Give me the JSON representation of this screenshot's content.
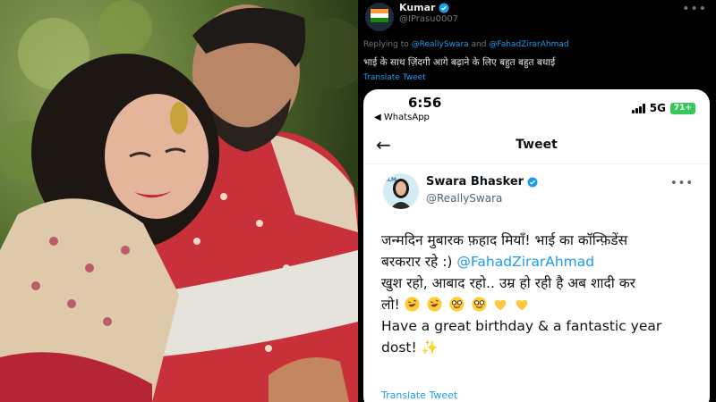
{
  "reply_tweet": {
    "author_name": "Kumar",
    "author_handle": "@IPrasu0007",
    "replying_prefix": "Replying to",
    "replying_to_1": "@ReallySwara",
    "replying_and": "and",
    "replying_to_2": "@FahadZirarAhmad",
    "text": "भाई के साथ ज़िंदगी आगे बढ़ाने के लिए बहुत बहुत बधाई",
    "translate_label": "Translate Tweet",
    "more_glyph": "•••"
  },
  "phone_status": {
    "time": "6:56",
    "back_app": "◀ WhatsApp",
    "network": "5G",
    "battery": "71+"
  },
  "tweet_screen": {
    "back_glyph": "←",
    "title": "Tweet",
    "author_name": "Swara Bhasker",
    "author_handle": "@ReallySwara",
    "more_glyph": "•••",
    "line1": "जन्मदिन मुबारक फ़हाद मियाँ! भाई का कॉन्फ़िडेंस",
    "line2_prefix": "बरकरार रहे :)",
    "line2_mention": "@FahadZirarAhmad",
    "line3": "खुश रहो, आबाद रहो..  उम्र हो रही है अब शादी कर",
    "line4_prefix": "लो!",
    "line5": "Have a great birthday & a fantastic year",
    "line6": "dost! ✨",
    "translate_label": "Translate Tweet"
  },
  "icons": {
    "verified": "verified-badge-icon",
    "emoji": [
      "rofl-emoji",
      "rofl-emoji",
      "nerd-emoji",
      "nerd-emoji",
      "yellow-heart",
      "yellow-heart"
    ]
  },
  "colors": {
    "link_blue": "#1d9bf0",
    "verified_blue": "#1d9bf0",
    "muted_text": "#71767b",
    "battery_green": "#34c759"
  }
}
